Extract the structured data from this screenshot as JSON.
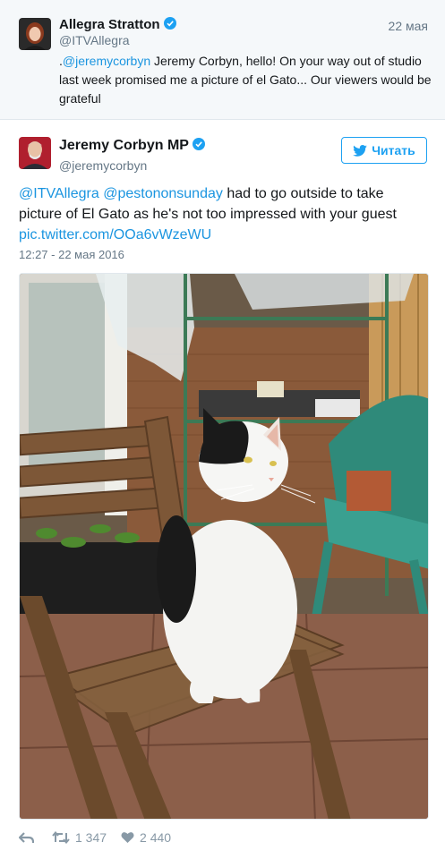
{
  "reply": {
    "name": "Allegra Stratton",
    "handle": "@ITVAllegra",
    "date": "22 мая",
    "text_prefix": ".",
    "mention": "@jeremycorbyn",
    "text_rest": " Jeremy Corbyn, hello! On your way out of studio last week promised me a picture of el Gato... Our viewers would be grateful"
  },
  "tweet": {
    "name": "Jeremy Corbyn MP",
    "handle": "@jeremycorbyn",
    "follow_label": "Читать",
    "mention1": "@ITVAllegra",
    "mention2": "@pestononsunday",
    "text": " had to go outside to take picture of El Gato as he's not too impressed with your guest ",
    "link": "pic.twitter.com/OOa6vWzeWU",
    "timestamp": "12:27 - 22 мая 2016"
  },
  "actions": {
    "retweets": "1 347",
    "likes": "2 440"
  },
  "icons": {
    "verified": "verified-badge-icon",
    "follow": "twitter-bird-icon",
    "reply": "reply-icon",
    "retweet": "retweet-icon",
    "like": "heart-icon"
  },
  "colors": {
    "link": "#1b95e0",
    "verified": "#1da1f2",
    "muted": "#657786"
  }
}
